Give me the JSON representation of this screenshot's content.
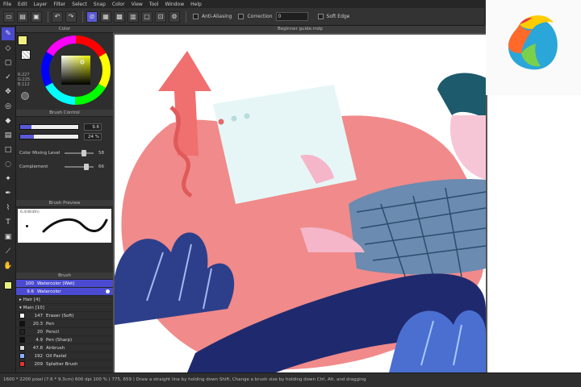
{
  "menu": [
    "File",
    "Edit",
    "Layer",
    "Filter",
    "Select",
    "Snap",
    "Color",
    "View",
    "Tool",
    "Window",
    "Help"
  ],
  "toolbar": {
    "antialiasing_label": "Anti-Aliasing",
    "correction_label": "Correction",
    "correction_value": "0",
    "soft_edge_label": "Soft Edge"
  },
  "panels": {
    "color_title": "Color",
    "color_values": [
      "R:227",
      "G:225",
      "B:112"
    ],
    "brush_control_title": "Brush Control",
    "brush_size_value": "9.6",
    "brush_opacity_value": "24 %",
    "brush_opacity_fraction": 0.24,
    "color_mixing_label": "Color Mixing Level",
    "color_mixing_value": "58",
    "complement_label": "Complement",
    "complement_value": "66",
    "brush_preview_title": "Brush Preview",
    "brush_preview_label": "6,4(Width)",
    "brush_title": "Brush"
  },
  "brushes": [
    {
      "size": "100",
      "name": "Watercolor (Wet)",
      "color": "#5a5ad8",
      "selected": true
    },
    {
      "size": "9.6",
      "name": "Watercolor",
      "color": "#5a5ad8",
      "selected": true
    }
  ],
  "brush_groups": [
    {
      "name": "Hair [4]"
    },
    {
      "name": "Main [10]"
    }
  ],
  "brush_items": [
    {
      "size": "147",
      "name": "Eraser (Soft)",
      "color": "#ffffff"
    },
    {
      "size": "20.3",
      "name": "Pen",
      "color": "#111111"
    },
    {
      "size": "20",
      "name": "Pencil",
      "color": "#222222"
    },
    {
      "size": "4.9",
      "name": "Pen (Sharp)",
      "color": "#111111"
    },
    {
      "size": "47.8",
      "name": "Airbrush",
      "color": "#d8d8d8"
    },
    {
      "size": "192",
      "name": "Oil Pastel",
      "color": "#8bb0ff"
    },
    {
      "size": "209",
      "name": "Splatter Brush",
      "color": "#e23232"
    }
  ],
  "document": {
    "tab_title": "Beginner guide.mdp"
  },
  "status": "1600 * 2200 pixel  (7.6 * 9.3cm)  600 dpi  100 %  ( 775, 659 )  Draw a straight line by holding down Shift, Change a brush size by holding down Ctrl, Alt, and dragging",
  "colors": {
    "accent": "#5a5ad8",
    "salmon": "#f18a8a",
    "navy": "#1f2a6e",
    "teal_hair": "#1d5a6c",
    "shirt": "#6b8bb0"
  }
}
